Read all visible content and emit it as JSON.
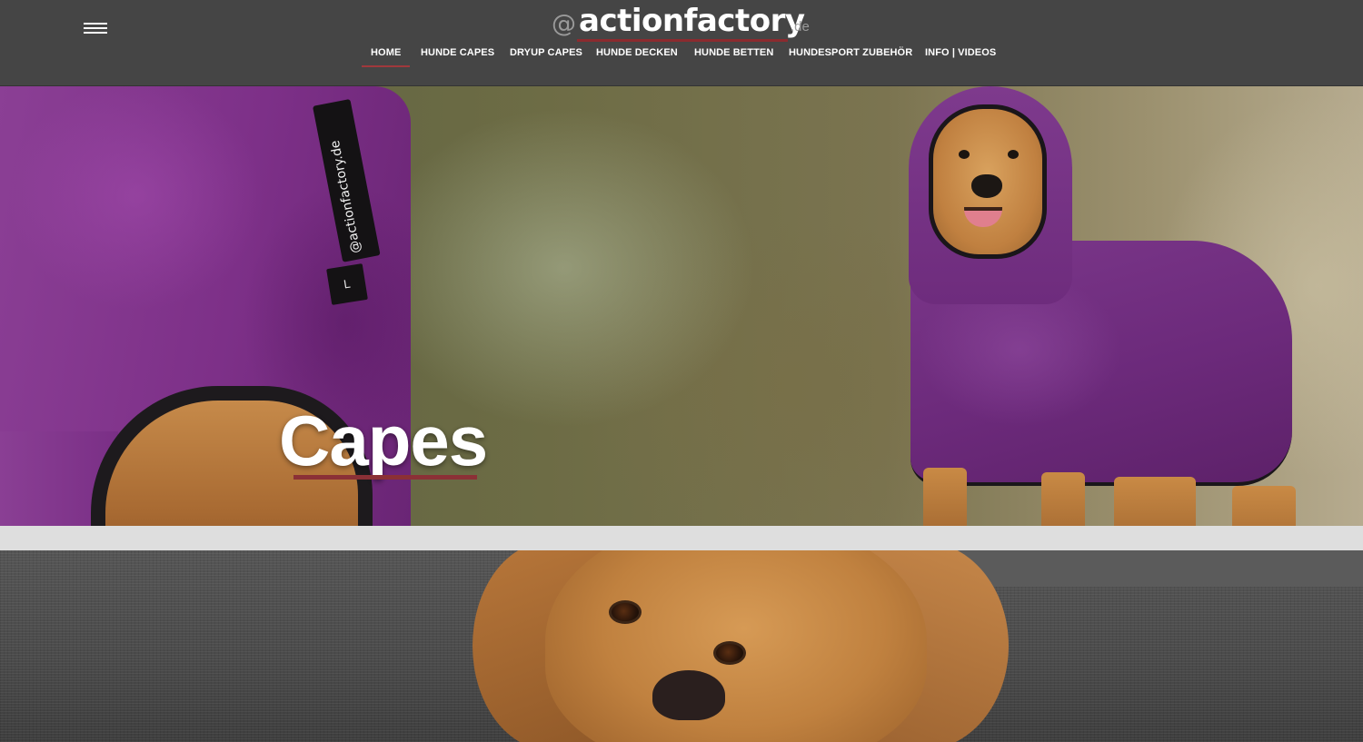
{
  "header": {
    "menu_icon": "hamburger-menu-icon",
    "logo": {
      "at": "@",
      "name": "actionfactory",
      "tld": ".de"
    },
    "nav": [
      {
        "label": "HOME",
        "active": true
      },
      {
        "label": "HUNDE CAPES",
        "active": false
      },
      {
        "label": "DRYUP CAPES",
        "active": false
      },
      {
        "label": "HUNDE DECKEN",
        "active": false
      },
      {
        "label": "HUNDE BETTEN",
        "active": false
      },
      {
        "label": "HUNDESPORT ZUBEHÖR",
        "active": false
      },
      {
        "label": "INFO | VIDEOS",
        "active": false
      }
    ]
  },
  "hero": {
    "title": "Capes",
    "label_tag": "@actionfactory.de",
    "size_tag": "L"
  },
  "colors": {
    "header_bg": "#454545",
    "accent": "#8b2b2f",
    "text": "#ffffff"
  }
}
